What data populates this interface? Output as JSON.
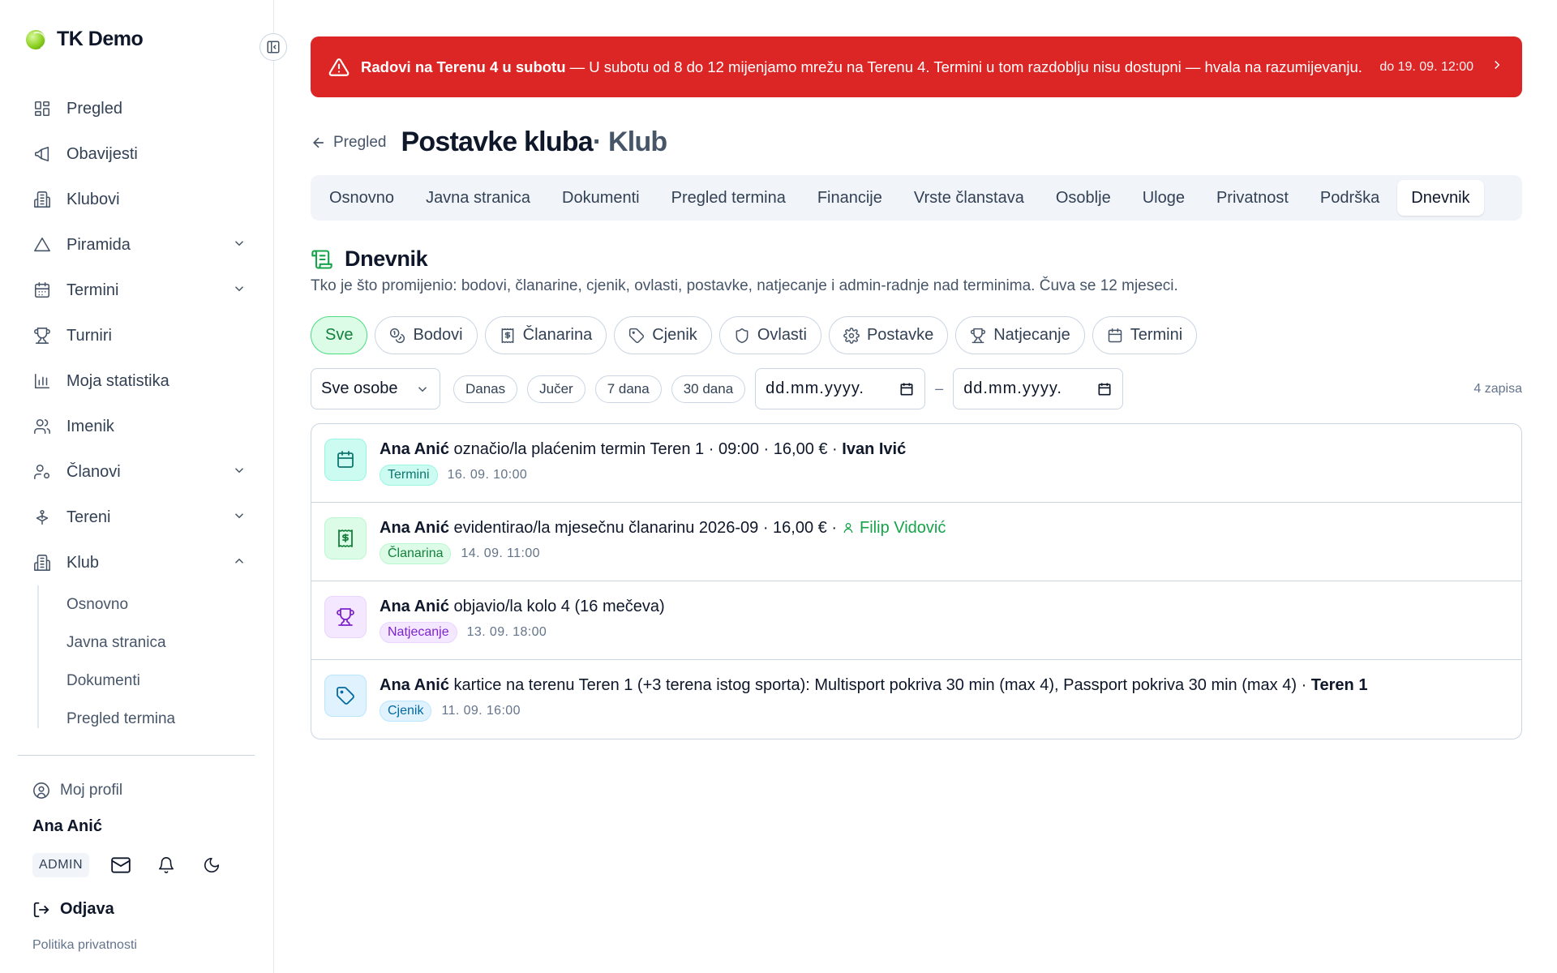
{
  "brand": {
    "name": "TK Demo"
  },
  "sidebar": {
    "items": [
      {
        "label": "Pregled",
        "icon": "layout-dashboard-icon",
        "expandable": false
      },
      {
        "label": "Obavijesti",
        "icon": "megaphone-icon",
        "expandable": false
      },
      {
        "label": "Klubovi",
        "icon": "building-icon",
        "expandable": false
      },
      {
        "label": "Piramida",
        "icon": "triangle-icon",
        "expandable": true
      },
      {
        "label": "Termini",
        "icon": "calendar-icon",
        "expandable": true
      },
      {
        "label": "Turniri",
        "icon": "trophy-icon",
        "expandable": false
      },
      {
        "label": "Moja statistika",
        "icon": "bar-chart-icon",
        "expandable": false
      },
      {
        "label": "Imenik",
        "icon": "users-icon",
        "expandable": false
      },
      {
        "label": "Članovi",
        "icon": "user-cog-icon",
        "expandable": true
      },
      {
        "label": "Tereni",
        "icon": "court-icon",
        "expandable": true
      },
      {
        "label": "Klub",
        "icon": "building-icon",
        "expandable": true,
        "expanded": true
      }
    ],
    "klub_subitems": [
      "Osnovno",
      "Javna stranica",
      "Dokumenti",
      "Pregled termina"
    ],
    "profile_label": "Moj profil",
    "user_name": "Ana Anić",
    "role": "ADMIN",
    "logout_label": "Odjava",
    "privacy_label": "Politika privatnosti"
  },
  "alert": {
    "title": "Radovi na Terenu 4 u subotu",
    "message": " — U subotu od 8 do 12 mijenjamo mrežu na Terenu 4. Termini u tom razdoblju nisu dostupni — hvala na razumijevanju.",
    "until": "do 19. 09. 12:00"
  },
  "header": {
    "back_label": "Pregled",
    "title": "Postavke kluba",
    "subtitle": " · Klub"
  },
  "tabs": [
    "Osnovno",
    "Javna stranica",
    "Dokumenti",
    "Pregled termina",
    "Financije",
    "Vrste članstava",
    "Osoblje",
    "Uloge",
    "Privatnost",
    "Podrška",
    "Dnevnik"
  ],
  "active_tab": "Dnevnik",
  "section": {
    "title": "Dnevnik",
    "description": "Tko je što promijenio: bodovi, članarine, cjenik, ovlasti, postavke, natjecanje i admin-radnje nad terminima. Čuva se 12 mjeseci."
  },
  "categories": [
    {
      "label": "Sve",
      "icon": "",
      "active": true
    },
    {
      "label": "Bodovi",
      "icon": "coins-icon",
      "active": false
    },
    {
      "label": "Članarina",
      "icon": "receipt-icon",
      "active": false
    },
    {
      "label": "Cjenik",
      "icon": "tag-icon",
      "active": false
    },
    {
      "label": "Ovlasti",
      "icon": "shield-icon",
      "active": false
    },
    {
      "label": "Postavke",
      "icon": "gear-icon",
      "active": false
    },
    {
      "label": "Natjecanje",
      "icon": "trophy-icon",
      "active": false
    },
    {
      "label": "Termini",
      "icon": "calendar-icon",
      "active": false
    }
  ],
  "filters": {
    "person_select": "Sve osobe",
    "quick_ranges": [
      "Danas",
      "Jučer",
      "7 dana",
      "30 dana"
    ],
    "date_from_placeholder": "dd.mm.yyyy.",
    "date_to_placeholder": "dd.mm.yyyy.",
    "range_separator": "–",
    "count": "4 zapisa"
  },
  "log": [
    {
      "actor": "Ana Anić",
      "action": " označio/la plaćenim termin Teren 1 · 09:00 · 16,00 € · ",
      "target": "Ivan Ivić",
      "target_style": "bold",
      "category": "Termini",
      "time": "16. 09. 10:00",
      "color": "teal",
      "icon": "calendar-icon"
    },
    {
      "actor": "Ana Anić",
      "action": " evidentirao/la mjesečnu članarinu 2026-09 · 16,00 € ·",
      "target": "Filip Vidović",
      "target_style": "user-link",
      "category": "Članarina",
      "time": "14. 09. 11:00",
      "color": "green",
      "icon": "receipt-icon"
    },
    {
      "actor": "Ana Anić",
      "action": " objavio/la kolo 4 (16 mečeva)",
      "target": "",
      "target_style": "none",
      "category": "Natjecanje",
      "time": "13. 09. 18:00",
      "color": "purple",
      "icon": "trophy-icon"
    },
    {
      "actor": "Ana Anić",
      "action": " kartice na terenu Teren 1 (+3 terena istog sporta): Multisport pokriva 30 min (max 4), Passport pokriva 30 min (max 4) · ",
      "target": "Teren 1",
      "target_style": "bold",
      "category": "Cjenik",
      "time": "11. 09. 16:00",
      "color": "sky",
      "icon": "tag-icon"
    }
  ]
}
